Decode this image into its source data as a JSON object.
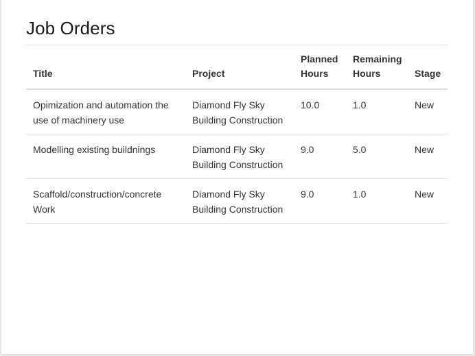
{
  "page": {
    "title": "Job Orders"
  },
  "table": {
    "headers": {
      "title": "Title",
      "project": "Project",
      "planned_hours": "Planned Hours",
      "remaining_hours": "Remaining Hours",
      "stage": "Stage"
    },
    "rows": [
      {
        "title": "Opimization and automation the use of machinery use",
        "project": "Diamond Fly Sky Building Construction",
        "planned_hours": "10.0",
        "remaining_hours": "1.0",
        "stage": "New"
      },
      {
        "title": "Modelling existing buildnings",
        "project": "Diamond Fly Sky Building Construction",
        "planned_hours": "9.0",
        "remaining_hours": "5.0",
        "stage": "New"
      },
      {
        "title": "Scaffold/construction/concrete Work",
        "project": "Diamond Fly Sky Building Construction",
        "planned_hours": "9.0",
        "remaining_hours": "1.0",
        "stage": "New"
      }
    ]
  }
}
